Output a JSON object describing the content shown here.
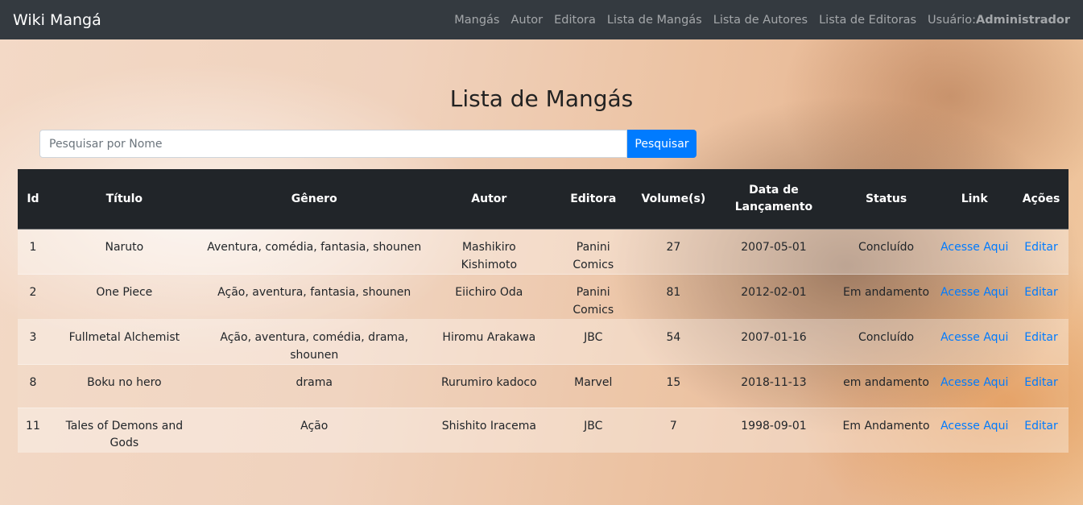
{
  "navbar": {
    "brand": "Wiki Mangá",
    "links": [
      "Mangás",
      "Autor",
      "Editora",
      "Lista de Mangás",
      "Lista de Autores",
      "Lista de Editoras"
    ],
    "user_label": "Usuário:",
    "user_name": "Administrador"
  },
  "page": {
    "title": "Lista de Mangás"
  },
  "search": {
    "placeholder": "Pesquisar por Nome",
    "button_label": "Pesquisar"
  },
  "table": {
    "headers": [
      "Id",
      "Título",
      "Gênero",
      "Autor",
      "Editora",
      "Volume(s)",
      "Data de Lançamento",
      "Status",
      "Link",
      "Ações"
    ],
    "rows": [
      {
        "id": "1",
        "titulo": "Naruto",
        "genero": "Aventura, comédia, fantasia, shounen",
        "autor": "Mashikiro Kishimoto",
        "editora": "Panini Comics",
        "volumes": "27",
        "data": "2007-05-01",
        "status": "Concluído",
        "link": "Acesse Aqui",
        "acao": "Editar"
      },
      {
        "id": "2",
        "titulo": "One Piece",
        "genero": "Ação, aventura, fantasia, shounen",
        "autor": "Eiichiro Oda",
        "editora": "Panini Comics",
        "volumes": "81",
        "data": "2012-02-01",
        "status": "Em andamento",
        "link": "Acesse Aqui",
        "acao": "Editar"
      },
      {
        "id": "3",
        "titulo": "Fullmetal Alchemist",
        "genero": "Ação, aventura, comédia, drama, shounen",
        "autor": "Hiromu Arakawa",
        "editora": "JBC",
        "volumes": "54",
        "data": "2007-01-16",
        "status": "Concluído",
        "link": "Acesse Aqui",
        "acao": "Editar"
      },
      {
        "id": "8",
        "titulo": "Boku no hero",
        "genero": "drama",
        "autor": "Rurumiro kadoco",
        "editora": "Marvel",
        "volumes": "15",
        "data": "2018-11-13",
        "status": "em andamento",
        "link": "Acesse Aqui",
        "acao": "Editar"
      },
      {
        "id": "11",
        "titulo": "Tales of Demons and Gods",
        "genero": "Ação",
        "autor": "Shishito Iracema",
        "editora": "JBC",
        "volumes": "7",
        "data": "1998-09-01",
        "status": "Em Andamento",
        "link": "Acesse Aqui",
        "acao": "Editar"
      }
    ]
  },
  "colors": {
    "navbar_bg": "#343a40",
    "table_header_bg": "#212529",
    "accent": "#007bff"
  }
}
